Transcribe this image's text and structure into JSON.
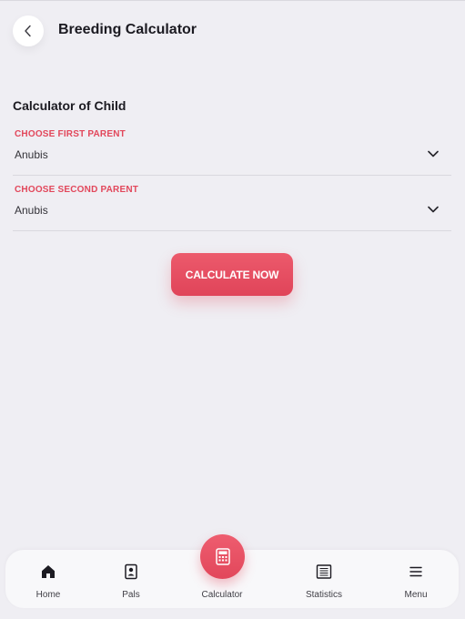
{
  "header": {
    "title": "Breeding Calculator"
  },
  "section": {
    "title": "Calculator of Child"
  },
  "selectors": [
    {
      "label": "CHOOSE FIRST PARENT",
      "value": "Anubis"
    },
    {
      "label": "CHOOSE SECOND PARENT",
      "value": "Anubis"
    }
  ],
  "action": {
    "label": "CALCULATE NOW"
  },
  "nav": {
    "items": [
      {
        "label": "Home",
        "icon": "home-icon"
      },
      {
        "label": "Pals",
        "icon": "pals-card-icon"
      },
      {
        "label": "Calculator",
        "icon": "calculator-icon"
      },
      {
        "label": "Statistics",
        "icon": "statistics-icon"
      },
      {
        "label": "Menu",
        "icon": "menu-icon"
      }
    ]
  },
  "colors": {
    "accent": "#e2475b",
    "background": "#efeef3",
    "surface": "#ffffff"
  }
}
